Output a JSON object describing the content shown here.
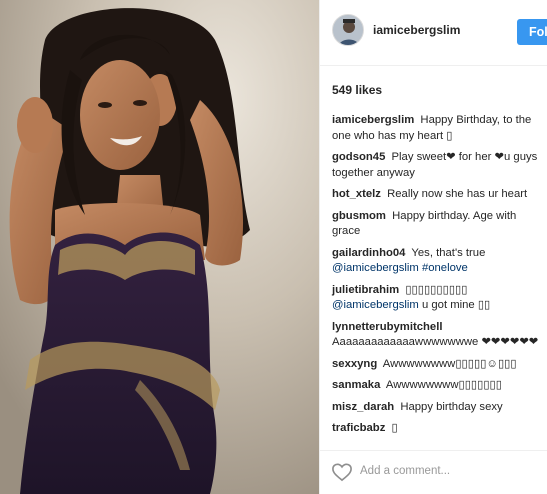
{
  "post": {
    "username": "iamicebergslim",
    "follow_label": "Follow",
    "likes_text": "549 likes",
    "add_comment_placeholder": "Add a comment..."
  },
  "comments": [
    {
      "user": "iamicebergslim",
      "text": "Happy Birthday, to the one who has my heart ▯"
    },
    {
      "user": "godson45",
      "text": "Play sweet❤ for her ❤u guys together anyway"
    },
    {
      "user": "hot_xtelz",
      "text": "Really now she has ur heart"
    },
    {
      "user": "gbusmom",
      "text": "Happy birthday. Age with grace"
    },
    {
      "user": "gailardinho04",
      "text": "Yes, that's true",
      "mention": "@iamicebergslim #onelove"
    },
    {
      "user": "julietibrahim",
      "text": "▯▯▯▯▯▯▯▯▯▯",
      "mention": "@iamicebergslim",
      "text2": "u got mine ▯▯"
    },
    {
      "user": "lynnetterubymitchell",
      "text": "Aaaaaaaaaaaaawwwwwwwe ❤❤❤❤❤❤"
    },
    {
      "user": "sexxyng",
      "text": "Awwwwwwww▯▯▯▯▯☺▯▯▯"
    },
    {
      "user": "sanmaka",
      "text": "Awwwwwwww▯▯▯▯▯▯▯"
    },
    {
      "user": "misz_darah",
      "text": "Happy birthday sexy"
    },
    {
      "user": "traficbabz",
      "text": "▯"
    }
  ],
  "icons": {
    "like": "heart-outline-icon",
    "avatar": "profile-avatar"
  },
  "colors": {
    "follow_button": "#3897f0",
    "mention": "#003569",
    "dress": "#2b1c3a",
    "embroidery": "#b89a5c"
  }
}
